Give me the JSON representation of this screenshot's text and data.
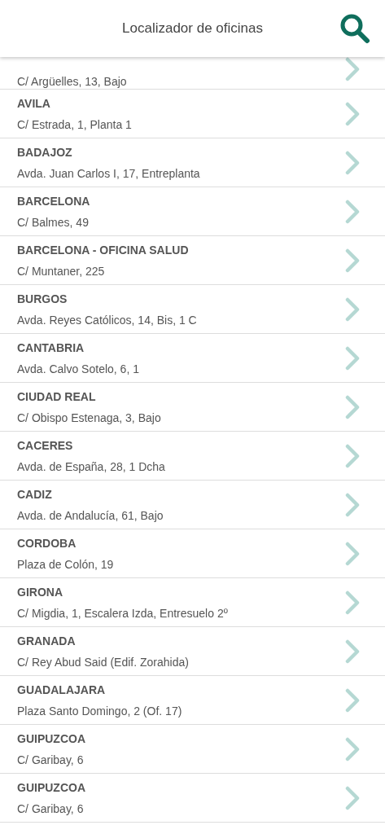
{
  "header": {
    "title": "Localizador de oficinas"
  },
  "offices": [
    {
      "address": "C/ Argüelles, 13, Bajo"
    },
    {
      "name": "AVILA",
      "address": "C/ Estrada, 1, Planta 1"
    },
    {
      "name": "BADAJOZ",
      "address": "Avda. Juan Carlos I, 17, Entreplanta"
    },
    {
      "name": "BARCELONA",
      "address": "C/ Balmes, 49"
    },
    {
      "name": "BARCELONA - OFICINA SALUD",
      "address": "C/ Muntaner, 225"
    },
    {
      "name": "BURGOS",
      "address": "Avda. Reyes Católicos, 14, Bis, 1 C"
    },
    {
      "name": "CANTABRIA",
      "address": "Avda. Calvo Sotelo, 6, 1"
    },
    {
      "name": "CIUDAD REAL",
      "address": "C/ Obispo Estenaga, 3, Bajo"
    },
    {
      "name": "CACERES",
      "address": "Avda. de España, 28, 1 Dcha"
    },
    {
      "name": "CADIZ",
      "address": "Avda. de Andalucía, 61, Bajo"
    },
    {
      "name": "CORDOBA",
      "address": "Plaza de Colón, 19"
    },
    {
      "name": "GIRONA",
      "address": "C/ Migdia, 1, Escalera Izda, Entresuelo 2º"
    },
    {
      "name": "GRANADA",
      "address": "C/ Rey Abud Said (Edif. Zorahida)"
    },
    {
      "name": "GUADALAJARA",
      "address": "Plaza Santo Domingo, 2 (Of. 17)"
    },
    {
      "name": "GUIPUZCOA",
      "address": "C/ Garibay, 6"
    },
    {
      "name": "GUIPUZCOA",
      "address": "C/ Garibay, 6"
    }
  ]
}
